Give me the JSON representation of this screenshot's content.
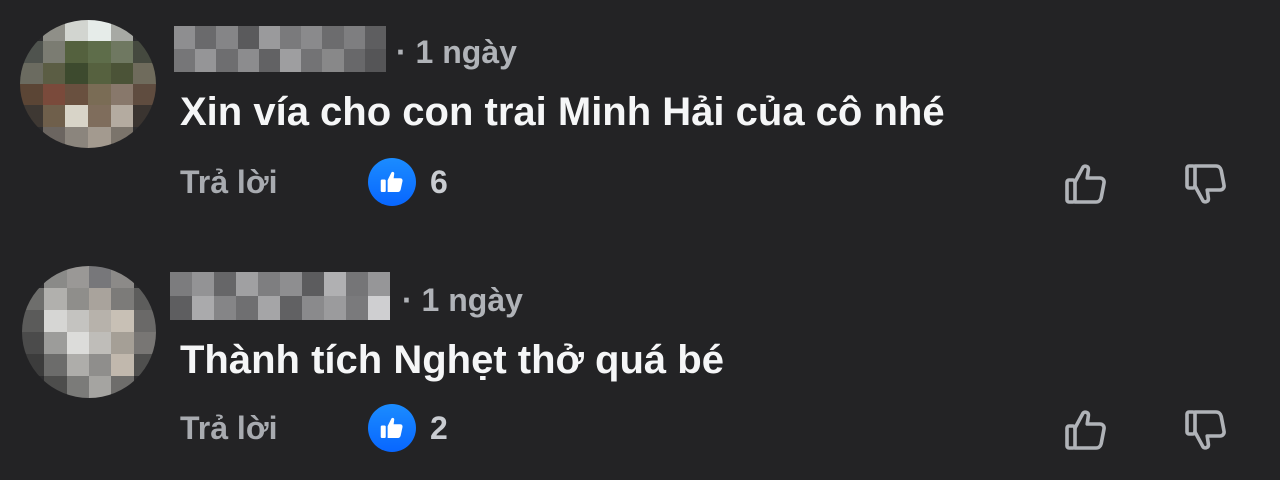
{
  "comments": [
    {
      "time": "· 1 ngày",
      "text": "Xin vía cho con trai Minh Hải của cô nhé",
      "reply_label": "Trả lời",
      "like_count": "6",
      "avatar_pixels": [
        "#2b2b2d",
        "#8f8f88",
        "#d2d5d0",
        "#e6ece9",
        "#a7a9a4",
        "#2b2b2d",
        "#4f534e",
        "#7b7c72",
        "#54613e",
        "#5e6d4a",
        "#6f7861",
        "#45493f",
        "#6b6b60",
        "#5b5d44",
        "#3d4a2e",
        "#56613f",
        "#4b5337",
        "#6f6b5c",
        "#5b4535",
        "#7a4a3b",
        "#69503f",
        "#7a6c55",
        "#88786b",
        "#5f4c3f",
        "#3e3833",
        "#6f5f4b",
        "#d8d4c8",
        "#7f6d5c",
        "#b4aba0",
        "#3a3430",
        "#2b2b2d",
        "#6b6560",
        "#8b857d",
        "#a39a8f",
        "#7b746b",
        "#2b2b2d"
      ],
      "name_pixels": [
        "#8e8e90",
        "#6a6a6c",
        "#858587",
        "#5a5a5c",
        "#9a9a9c",
        "#7a7a7c",
        "#8a8a8c",
        "#6c6c6e",
        "#7e7e80",
        "#5e5e60",
        "#767678",
        "#959597",
        "#6e6e70",
        "#8c8c8e",
        "#626264",
        "#9e9ea0",
        "#737375",
        "#888889",
        "#68686a",
        "#555557"
      ]
    },
    {
      "time": "· 1 ngày",
      "text": "Thành tích Nghẹt thở quá bé",
      "reply_label": "Trả lời",
      "like_count": "2",
      "avatar_pixels": [
        "#2b2b2d",
        "#8a8a88",
        "#9a9896",
        "#77777a",
        "#8c8a88",
        "#2b2b2d",
        "#6e6e6c",
        "#b1b0ad",
        "#8f8e8b",
        "#a9a39c",
        "#7c7b79",
        "#5d5d5c",
        "#5b5b5a",
        "#d6d6d4",
        "#c4c3c0",
        "#b7b2ab",
        "#c8c0b5",
        "#6a6968",
        "#4b4b4b",
        "#9c9c9a",
        "#dcdcda",
        "#bfbdb9",
        "#a59f96",
        "#787674",
        "#3c3c3c",
        "#6c6c6b",
        "#aeadaa",
        "#8f8e8c",
        "#c1b8ad",
        "#4f4f4e",
        "#2b2b2d",
        "#4d4d4c",
        "#7b7b79",
        "#a5a4a1",
        "#6e6d6b",
        "#2b2b2d"
      ],
      "name_pixels": [
        "#7c7c7e",
        "#939395",
        "#666668",
        "#a0a0a2",
        "#7e7e80",
        "#8e8e90",
        "#5c5c5e",
        "#b0b0b2",
        "#757577",
        "#969698",
        "#5e5e60",
        "#aaaaac",
        "#858587",
        "#6f6f71",
        "#a5a5a7",
        "#616163",
        "#8a8a8c",
        "#9b9b9d",
        "#7a7a7c",
        "#cfcfd1"
      ]
    }
  ],
  "colors": {
    "background": "#232325",
    "like_blue": "#0866ff",
    "icon_gray": "#b0b3b8"
  },
  "icons": {
    "like_badge": "thumbs-up-icon",
    "upvote": "thumbs-up-outline-icon",
    "downvote": "thumbs-down-outline-icon"
  }
}
